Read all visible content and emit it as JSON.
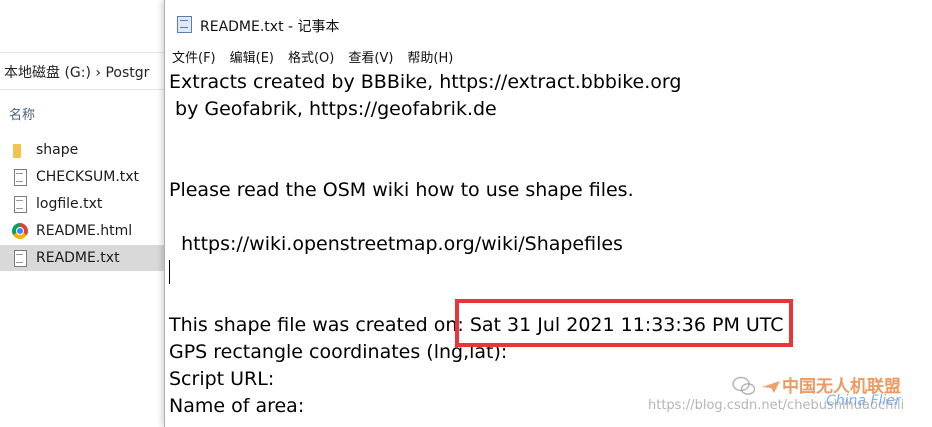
{
  "explorer": {
    "address": "本地磁盘 (G:)  ›  Postgr",
    "column_header": "名称",
    "files": [
      {
        "name": "shape",
        "icon": "folder-icon",
        "selected": false
      },
      {
        "name": "CHECKSUM.txt",
        "icon": "text-file-icon",
        "selected": false
      },
      {
        "name": "logfile.txt",
        "icon": "text-file-icon",
        "selected": false
      },
      {
        "name": "README.html",
        "icon": "chrome-icon",
        "selected": false
      },
      {
        "name": "README.txt",
        "icon": "text-file-icon",
        "selected": true
      }
    ]
  },
  "notepad": {
    "title": "README.txt - 记事本",
    "menu": [
      "文件(F)",
      "编辑(E)",
      "格式(O)",
      "查看(V)",
      "帮助(H)"
    ],
    "lines": [
      "Extracts created by BBBike, https://extract.bbbike.org",
      " by Geofabrik, https://geofabrik.de",
      "",
      "",
      "Please read the OSM wiki how to use shape files.",
      "",
      "  https://wiki.openstreetmap.org/wiki/Shapefiles",
      "",
      "",
      "This shape file was created on: Sat 31 Jul 2021 11:33:36 PM UTC",
      "GPS rectangle coordinates (lng,lat):",
      "Script URL:",
      "Name of area:"
    ],
    "highlight_color": "#e8343b"
  },
  "watermark": {
    "url": "https://blog.csdn.net/chebushihuaochili",
    "brand_cn": "中国无人机联盟",
    "brand_en": "China Flier"
  }
}
